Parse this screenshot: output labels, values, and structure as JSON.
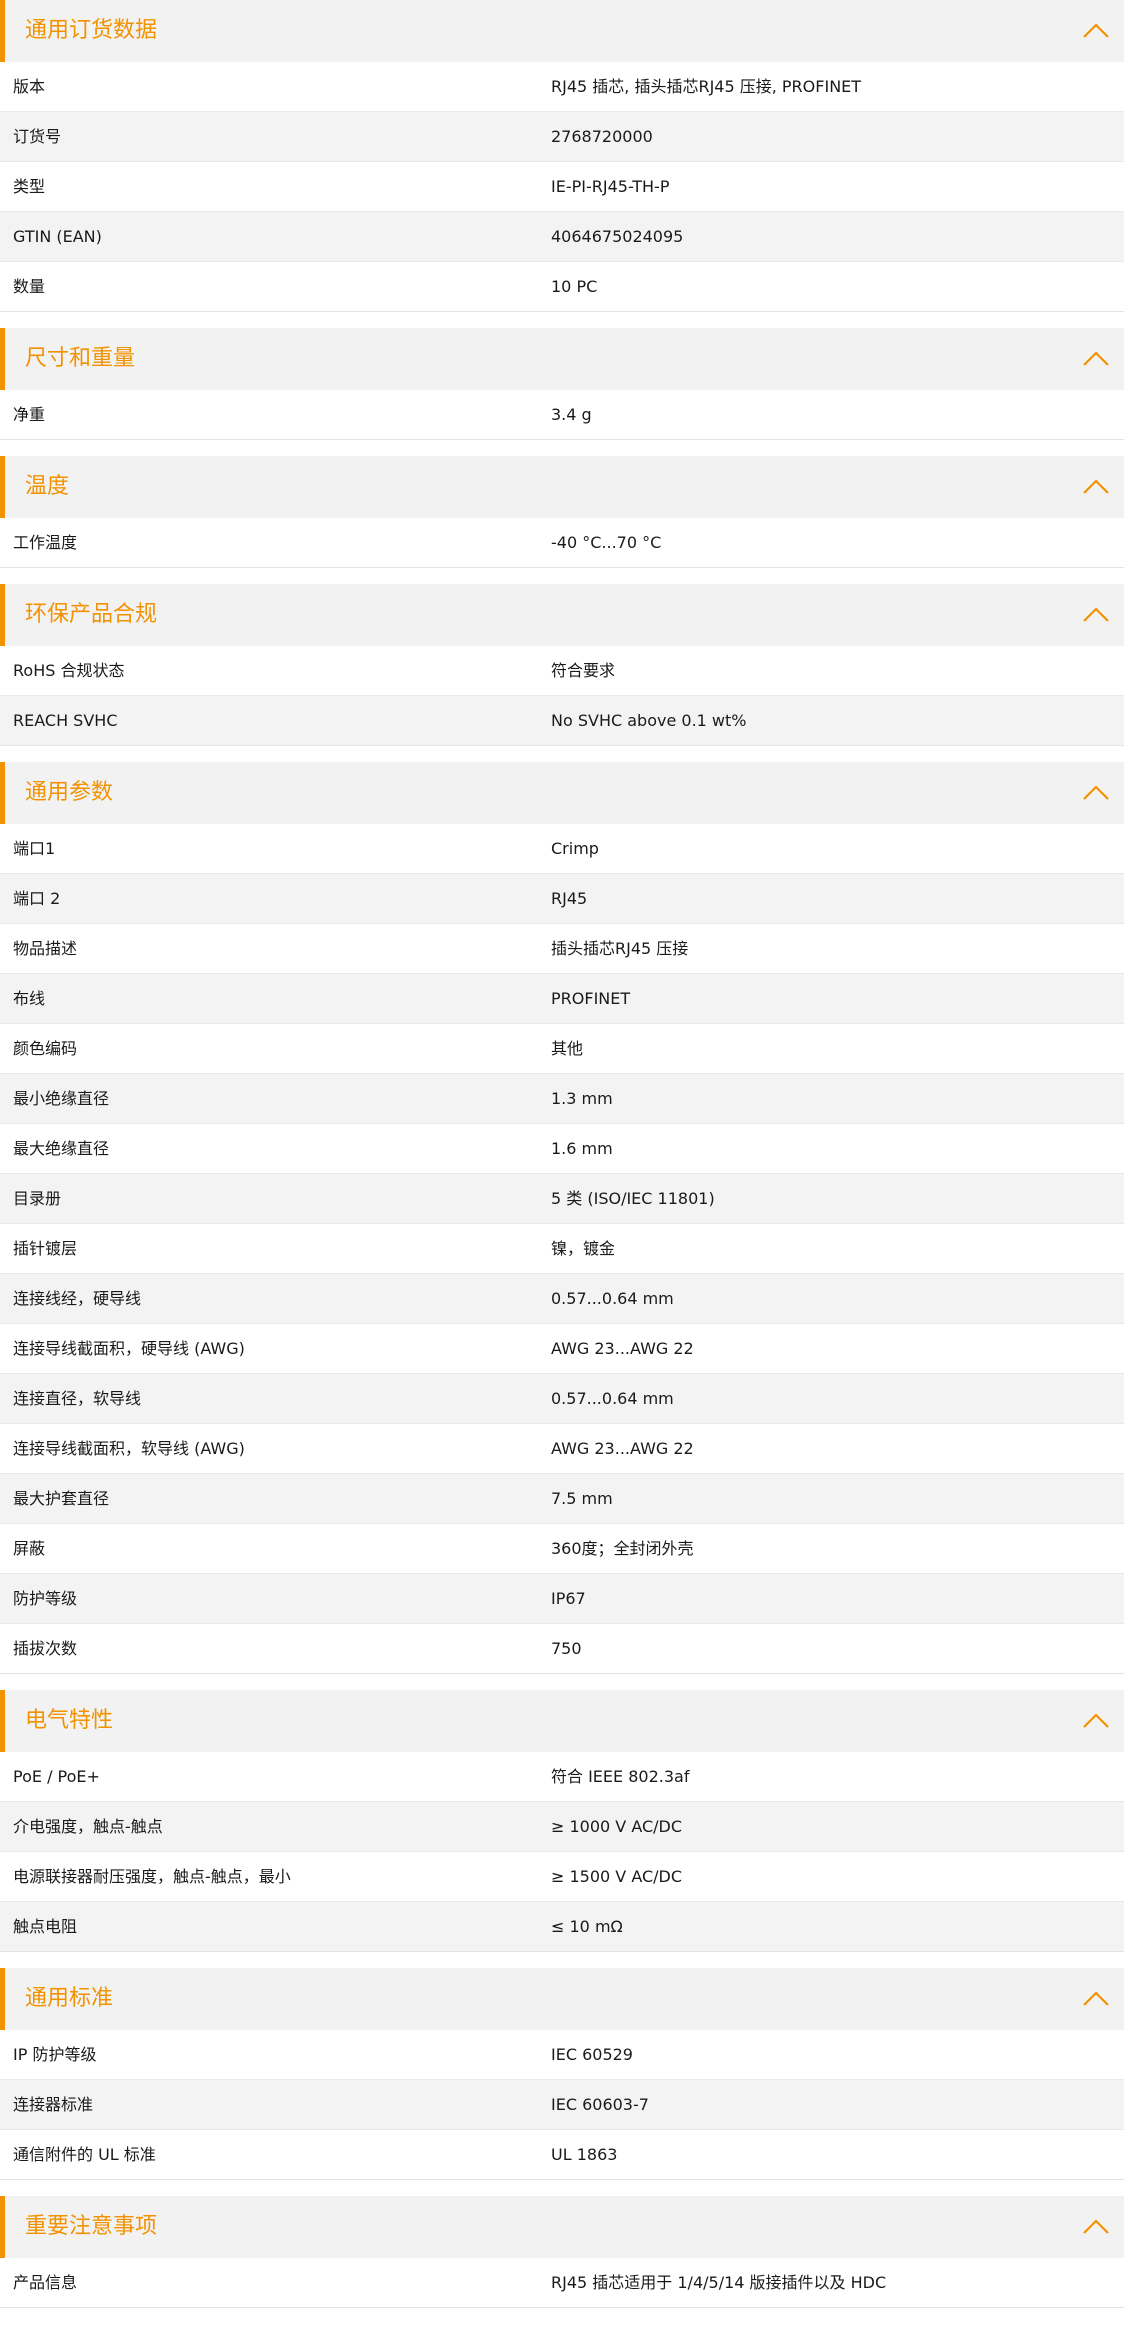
{
  "accent_color": "#f39200",
  "chevron_icon": "chevron-up-icon",
  "sections": [
    {
      "title": "通用订货数据",
      "rows": [
        {
          "label": "版本",
          "value": "RJ45 插芯, 插头插芯RJ45 压接, PROFINET"
        },
        {
          "label": "订货号",
          "value": "2768720000"
        },
        {
          "label": "类型",
          "value": "IE-PI-RJ45-TH-P"
        },
        {
          "label": "GTIN (EAN)",
          "value": "4064675024095"
        },
        {
          "label": "数量",
          "value": "10  PC"
        }
      ]
    },
    {
      "title": "尺寸和重量",
      "rows": [
        {
          "label": "净重",
          "value": "3.4  g"
        }
      ]
    },
    {
      "title": "温度",
      "rows": [
        {
          "label": "工作温度",
          "value": "-40 °C...70 °C"
        }
      ]
    },
    {
      "title": "环保产品合规",
      "rows": [
        {
          "label": "RoHS 合规状态",
          "value": "符合要求"
        },
        {
          "label": "REACH SVHC",
          "value": "No SVHC above 0.1 wt%"
        }
      ]
    },
    {
      "title": "通用参数",
      "rows": [
        {
          "label": "端口1",
          "value": "Crimp"
        },
        {
          "label": "端口 2",
          "value": "RJ45"
        },
        {
          "label": "物品描述",
          "value": "插头插芯RJ45 压接"
        },
        {
          "label": "布线",
          "value": "PROFINET"
        },
        {
          "label": "颜色编码",
          "value": "其他"
        },
        {
          "label": "最小绝缘直径",
          "value": "1.3  mm"
        },
        {
          "label": "最大绝缘直径",
          "value": "1.6  mm"
        },
        {
          "label": "目录册",
          "value": "5 类 (ISO/IEC 11801)"
        },
        {
          "label": "插针镀层",
          "value": "镍，镀金"
        },
        {
          "label": "连接线经，硬导线",
          "value": "0.57...0.64 mm"
        },
        {
          "label": "连接导线截面积，硬导线 (AWG)",
          "value": "AWG 23...AWG 22"
        },
        {
          "label": "连接直径，软导线",
          "value": "0.57...0.64 mm"
        },
        {
          "label": "连接导线截面积，软导线 (AWG)",
          "value": "AWG 23...AWG 22"
        },
        {
          "label": "最大护套直径",
          "value": "7.5  mm"
        },
        {
          "label": "屏蔽",
          "value": "360度；全封闭外壳"
        },
        {
          "label": "防护等级",
          "value": "IP67"
        },
        {
          "label": "插拔次数",
          "value": "750"
        }
      ]
    },
    {
      "title": "电气特性",
      "rows": [
        {
          "label": "PoE / PoE+",
          "value": "符合 IEEE 802.3af"
        },
        {
          "label": "介电强度，触点-触点",
          "value": "≥ 1000 V AC/DC"
        },
        {
          "label": "电源联接器耐压强度，触点-触点，最小",
          "value": "≥ 1500 V AC/DC"
        },
        {
          "label": "触点电阻",
          "value": "≤ 10 mΩ"
        }
      ]
    },
    {
      "title": "通用标准",
      "rows": [
        {
          "label": "IP 防护等级",
          "value": "IEC 60529"
        },
        {
          "label": "连接器标准",
          "value": "IEC 60603-7"
        },
        {
          "label": "通信附件的 UL 标准",
          "value": "UL 1863"
        }
      ]
    },
    {
      "title": "重要注意事项",
      "rows": [
        {
          "label": "产品信息",
          "value": "RJ45 插芯适用于 1/4/5/14 版接插件以及 HDC"
        }
      ]
    }
  ]
}
